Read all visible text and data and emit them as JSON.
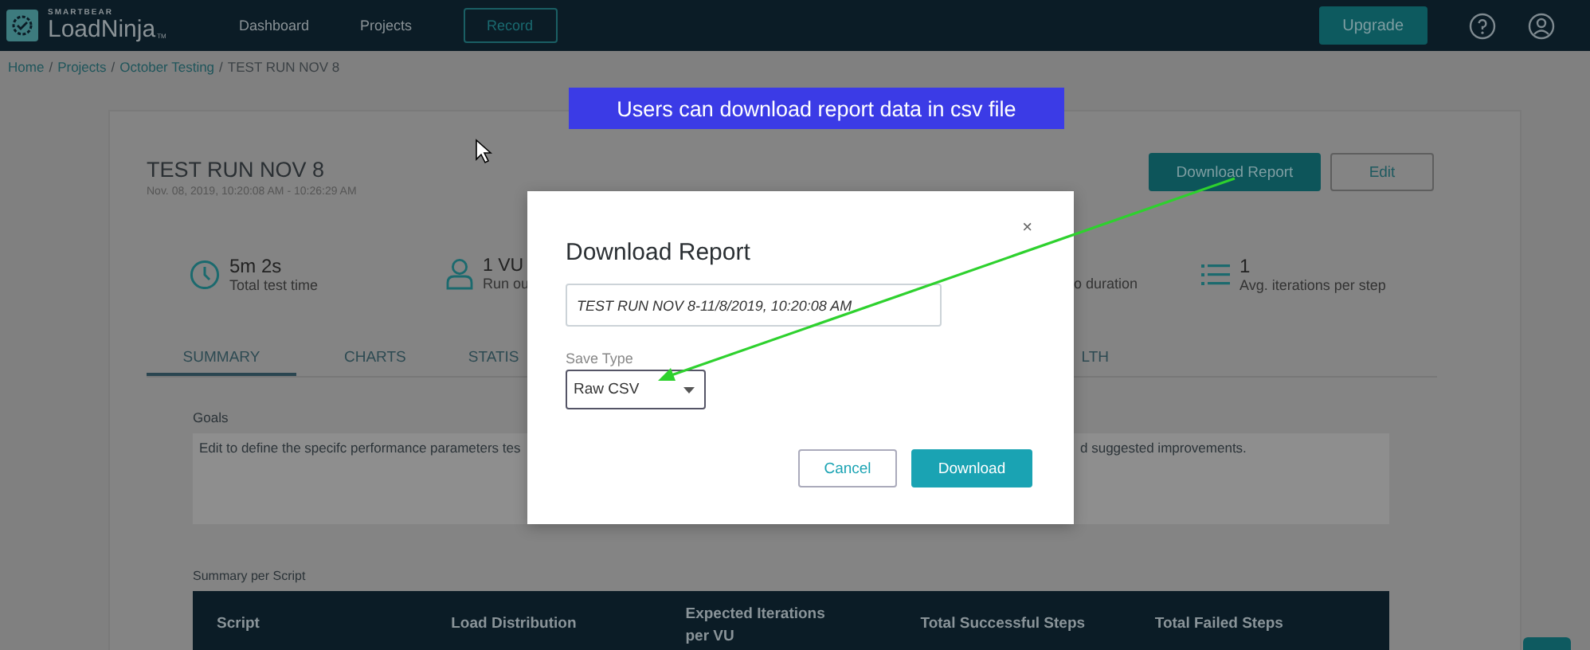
{
  "nav": {
    "brand_small": "SMARTBEAR",
    "brand": "LoadNinja",
    "brand_mark": "TM",
    "items": [
      {
        "label": "Dashboard",
        "kind": "link"
      },
      {
        "label": "Projects",
        "kind": "link"
      },
      {
        "label": "Record",
        "kind": "outlined"
      }
    ],
    "upgrade": "Upgrade"
  },
  "breadcrumb": {
    "separator": "/",
    "items": [
      {
        "label": "Home",
        "link": true
      },
      {
        "label": "Projects",
        "link": true
      },
      {
        "label": "October Testing",
        "link": true
      },
      {
        "label": "TEST RUN NOV 8",
        "link": false
      }
    ]
  },
  "annotation": {
    "callout": "Users can download report data in csv file"
  },
  "run": {
    "title": "TEST RUN NOV 8",
    "time_range": "Nov. 08, 2019, 10:20:08 AM - 10:26:29 AM",
    "buttons": [
      {
        "label": "Download Report",
        "kind": "primary"
      },
      {
        "label": "Edit",
        "kind": "outline"
      }
    ]
  },
  "stats": [
    {
      "kind": "clock",
      "value": "5m 2s",
      "label": "Total test time"
    },
    {
      "kind": "user",
      "value": "1 VU",
      "label": "Run ou"
    },
    {
      "kind": "partial",
      "label": "o duration"
    },
    {
      "kind": "list",
      "value": "1",
      "label": "Avg. iterations per step"
    }
  ],
  "tabs": [
    {
      "label": "SUMMARY",
      "selected": true
    },
    {
      "label": "CHARTS",
      "selected": false
    },
    {
      "label": "STATIS",
      "selected": false
    },
    {
      "label": "LTH",
      "selected": false
    }
  ],
  "goals": {
    "label": "Goals",
    "text_left": "Edit to define the specifc performance parameters tes",
    "text_right": "d suggested improvements."
  },
  "summary_per_script": {
    "title": "Summary per Script",
    "columns": [
      "Script",
      "Load Distribution",
      "Expected Iterations per VU",
      "Total Successful Steps",
      "Total Failed Steps"
    ]
  },
  "dialog": {
    "title": "Download Report",
    "close": "×",
    "name_value": "TEST RUN NOV 8-11/8/2019, 10:20:08 AM",
    "save_type_label": "Save Type",
    "save_type_value": "Raw CSV",
    "buttons": [
      {
        "label": "Cancel",
        "kind": "secondary"
      },
      {
        "label": "Download",
        "kind": "primary"
      }
    ]
  }
}
